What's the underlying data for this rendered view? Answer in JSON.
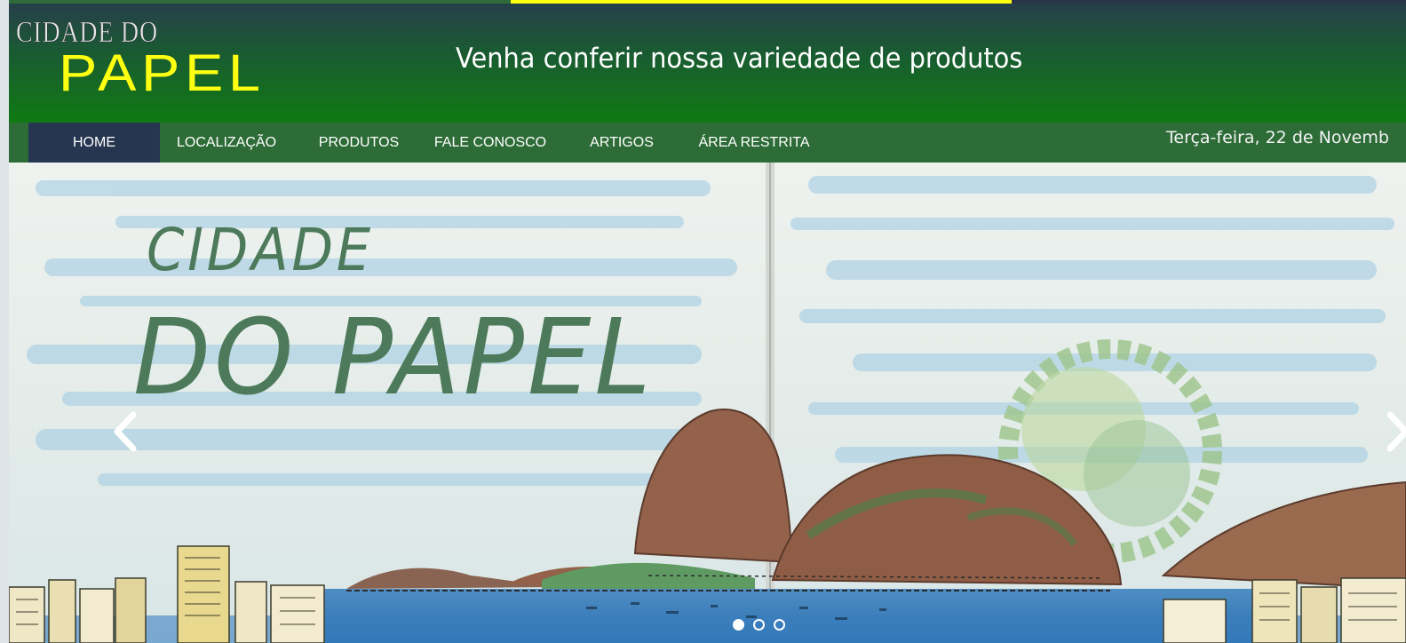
{
  "header": {
    "logo_line1": "CIDADE DO",
    "logo_line2": "PAPEL",
    "tagline": "Venha conferir nossa variedade de produtos"
  },
  "nav": {
    "items": [
      {
        "label": "HOME",
        "active": true
      },
      {
        "label": "LOCALIZAÇÃO",
        "active": false
      },
      {
        "label": "PRODUTOS",
        "active": false
      },
      {
        "label": "FALE CONOSCO",
        "active": false
      },
      {
        "label": "ARTIGOS",
        "active": false
      },
      {
        "label": "ÁREA RESTRITA",
        "active": false
      }
    ],
    "date": "Terça-feira, 22 de Novemb"
  },
  "hero": {
    "title_line1": "CIDADE",
    "title_line2": "DO PAPEL",
    "slides": 3,
    "active_slide": 1,
    "prev_icon": "chevron-left-icon",
    "next_icon": "chevron-right-icon"
  },
  "colors": {
    "header_top": "#273f4a",
    "header_bottom": "#107a12",
    "nav_bg": "#2d6c37",
    "nav_active": "#263550",
    "logo_yellow": "#ffff12",
    "hero_text": "#4c7a5a"
  }
}
